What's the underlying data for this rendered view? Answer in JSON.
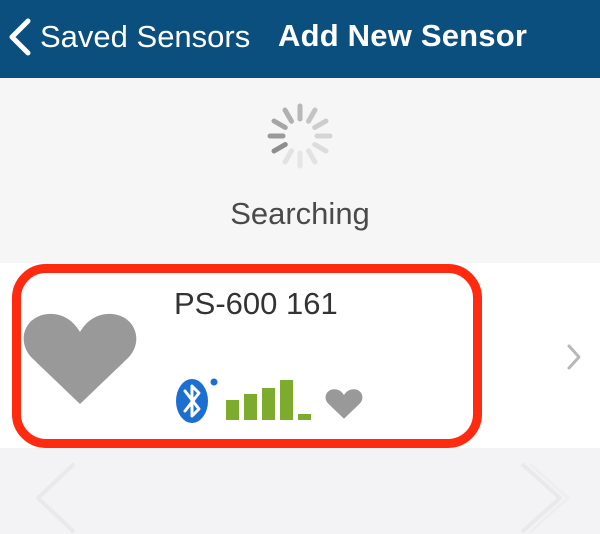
{
  "nav": {
    "back_label": "Saved Sensors",
    "title": "Add New Sensor",
    "back_icon": "chevron-left-icon"
  },
  "status": {
    "text": "Searching",
    "icon": "activity-spinner-icon"
  },
  "sensor": {
    "name": "PS-600 161",
    "type_icon": "heart-icon",
    "connection_icon": "bluetooth-icon",
    "signal_icon": "signal-strength-icon",
    "signal_level": 0.8,
    "sensor_icon": "heart-icon",
    "row_icon": "chevron-right-icon"
  },
  "colors": {
    "nav_background": "#0b4f7e",
    "highlight": "#ff2a10",
    "signal": "#7cab2e",
    "bluetooth": "#1c6fd1",
    "heart": "#999999"
  }
}
